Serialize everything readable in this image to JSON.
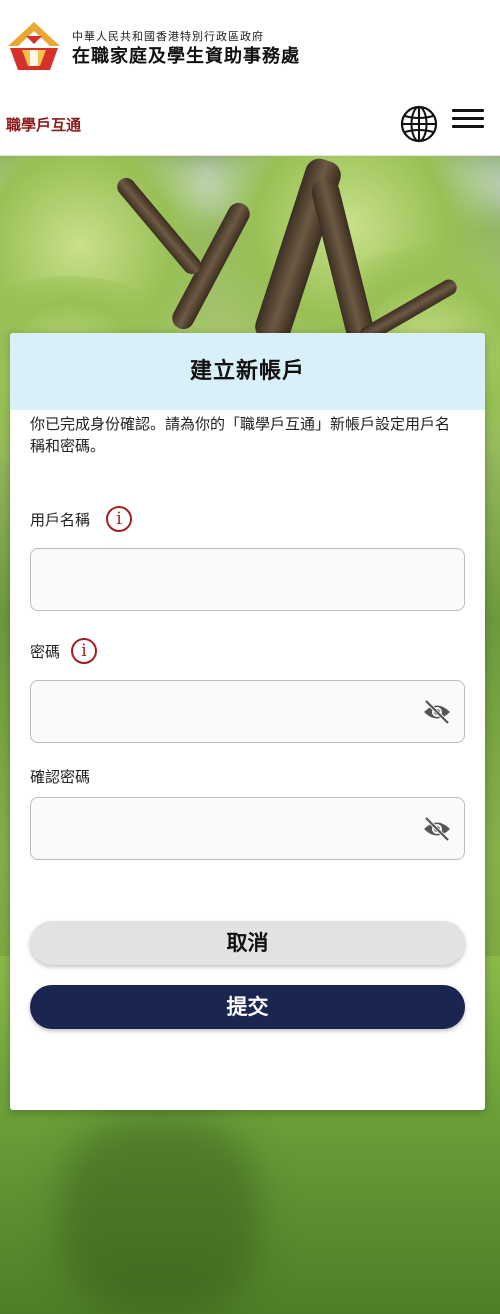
{
  "header": {
    "gov_name_small": "中華人民共和國香港特別行政區政府",
    "gov_office_name": "在職家庭及學生資助事務處",
    "brand_link": "職學戶互通"
  },
  "form": {
    "title": "建立新帳戶",
    "intro": "你已完成身份確認。請為你的「職學戶互通」新帳戶設定用戶名稱和密碼。",
    "username_label": "用戶名稱",
    "username_value": "",
    "password_label": "密碼",
    "password_value": "",
    "confirm_label": "確認密碼",
    "confirm_value": "",
    "cancel_label": "取消",
    "submit_label": "提交"
  },
  "icons": {
    "logo": "wfsfaa-logo",
    "language": "globe-icon",
    "menu": "hamburger-menu-icon",
    "info": "info-icon",
    "toggle_password": "eye-slash-icon"
  },
  "colors": {
    "brand_red": "#8b1a1a",
    "info_red": "#a31f1f",
    "card_header": "#d9f0f8",
    "submit_navy": "#1a2550",
    "cancel_gray": "#e2e2e2"
  }
}
